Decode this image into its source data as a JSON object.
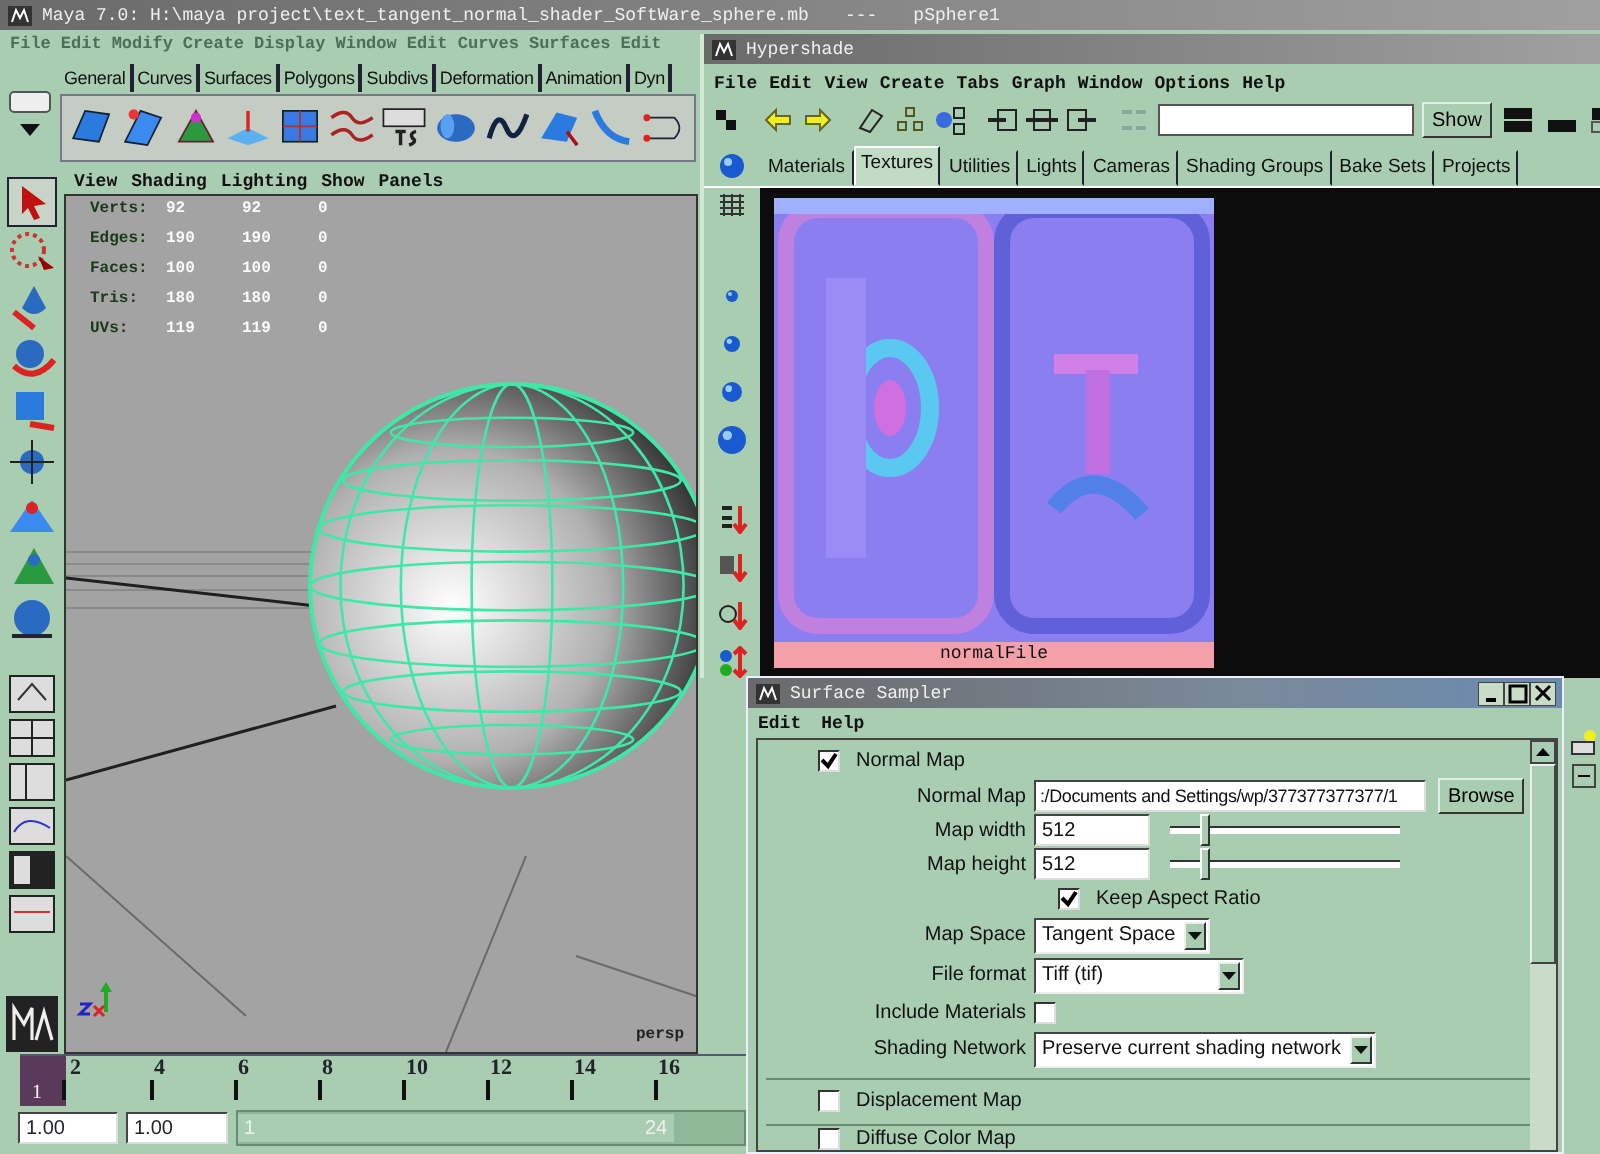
{
  "main_window": {
    "title": "Maya 7.0: H:\\maya project\\text_tangent_normal_shader_SoftWare_sphere.mb",
    "title_separator": "---",
    "selected_object": "pSphere1",
    "menu": [
      "File",
      "Edit",
      "Modify",
      "Create",
      "Display",
      "Window",
      "Edit Curves",
      "Surfaces",
      "Edit"
    ],
    "shelf_tabs": [
      "General",
      "Curves",
      "Surfaces",
      "Polygons",
      "Subdivs",
      "Deformation",
      "Animation",
      "Dyn"
    ],
    "viewport": {
      "menu": [
        "View",
        "Shading",
        "Lighting",
        "Show",
        "Panels"
      ],
      "stats": [
        {
          "label": "Verts:",
          "values": [
            "92",
            "92",
            "0"
          ]
        },
        {
          "label": "Edges:",
          "values": [
            "190",
            "190",
            "0"
          ]
        },
        {
          "label": "Faces:",
          "values": [
            "100",
            "100",
            "0"
          ]
        },
        {
          "label": "Tris:",
          "values": [
            "180",
            "180",
            "0"
          ]
        },
        {
          "label": "UVs:",
          "values": [
            "119",
            "119",
            "0"
          ]
        }
      ],
      "camera": "persp"
    },
    "timeline": {
      "current_frame": "1",
      "ticks": [
        "2",
        "4",
        "6",
        "8",
        "10",
        "12",
        "14",
        "16"
      ]
    },
    "range": {
      "start_time": "1.00",
      "playback_start": "1.00",
      "range_start": "1",
      "range_end": "24",
      "level": 0.86
    }
  },
  "hypershade": {
    "title": "Hypershade",
    "menu": [
      "File",
      "Edit",
      "View",
      "Create",
      "Tabs",
      "Graph",
      "Window",
      "Options",
      "Help"
    ],
    "show_button": "Show",
    "tabs": [
      {
        "label": "Materials",
        "selected": false
      },
      {
        "label": "Textures",
        "selected": true
      },
      {
        "label": "Utilities",
        "selected": false
      },
      {
        "label": "Lights",
        "selected": false
      },
      {
        "label": "Cameras",
        "selected": false
      },
      {
        "label": "Shading Groups",
        "selected": false
      },
      {
        "label": "Bake Sets",
        "selected": false
      },
      {
        "label": "Projects",
        "selected": false
      }
    ],
    "swatch": {
      "kind": "picture",
      "label": "normalFile"
    }
  },
  "surface_sampler": {
    "title": "Surface Sampler",
    "menu": [
      "Edit",
      "Help"
    ],
    "normal_map": {
      "label": "Normal Map",
      "checked": true
    },
    "fields": [
      {
        "kind": "path",
        "label": "Normal Map",
        "value": ":/Documents and Settings/wp/377377377377/1",
        "button": "Browse"
      },
      {
        "kind": "slider",
        "label": "Map width",
        "value": "512",
        "level": 0.14
      },
      {
        "kind": "slider",
        "label": "Map height",
        "value": "512",
        "level": 0.14
      },
      {
        "kind": "checkbox",
        "label": "Keep Aspect Ratio",
        "checked": true
      },
      {
        "kind": "dropdown",
        "label": "Map Space",
        "value": "Tangent Space"
      },
      {
        "kind": "dropdown",
        "label": "File format",
        "value": "Tiff (tif)"
      },
      {
        "kind": "check_right",
        "label": "Include Materials",
        "checked": false
      },
      {
        "kind": "dropdown",
        "label": "Shading Network",
        "value": "Preserve current shading network"
      }
    ],
    "sections": [
      {
        "label": "Displacement Map",
        "checked": false
      },
      {
        "label": "Diffuse Color Map",
        "checked": false
      }
    ]
  }
}
